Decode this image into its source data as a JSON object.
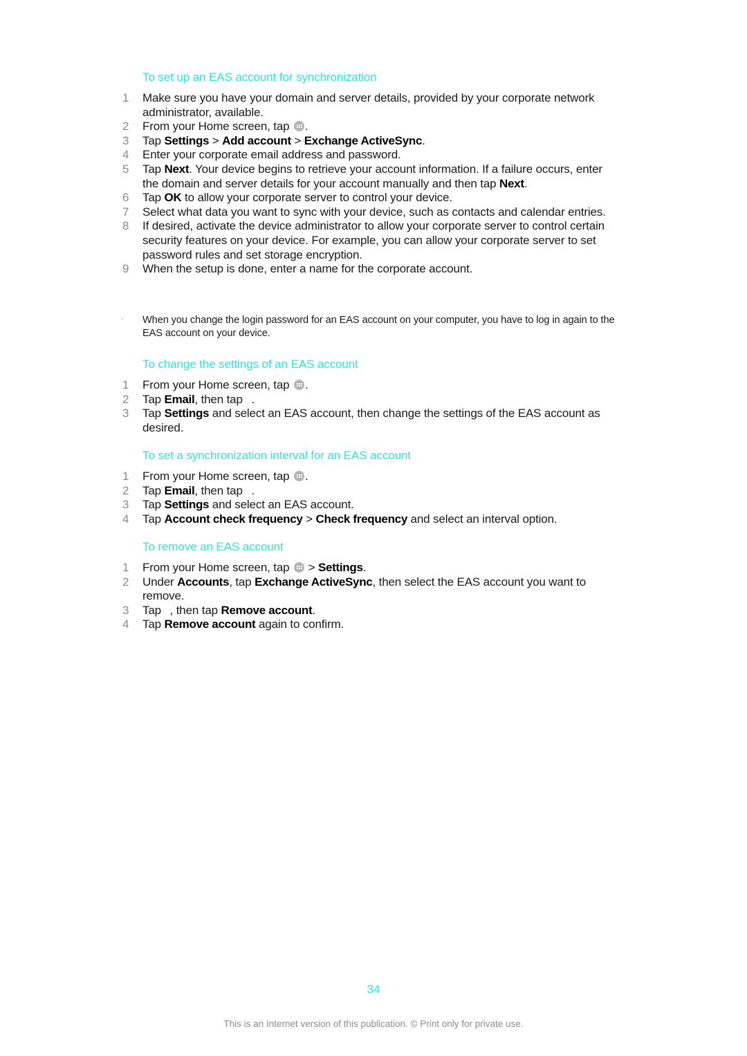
{
  "accent_color": "#2ee6d6",
  "sections": [
    {
      "heading": "To set up an EAS account for synchronization",
      "steps": [
        {
          "num": "1",
          "parts": [
            {
              "t": "Make sure you have your domain and server details, provided by your corporate network administrator, available."
            }
          ]
        },
        {
          "num": "2",
          "parts": [
            {
              "t": "From your Home screen, tap "
            },
            {
              "icon": "apps-icon"
            },
            {
              "t": "."
            }
          ]
        },
        {
          "num": "3",
          "parts": [
            {
              "t": "Tap "
            },
            {
              "b": "Settings"
            },
            {
              "t": " > "
            },
            {
              "b": "Add account"
            },
            {
              "t": " > "
            },
            {
              "b": "Exchange ActiveSync"
            },
            {
              "t": "."
            }
          ]
        },
        {
          "num": "4",
          "parts": [
            {
              "t": "Enter your corporate email address and password."
            }
          ]
        },
        {
          "num": "5",
          "parts": [
            {
              "t": "Tap "
            },
            {
              "b": "Next"
            },
            {
              "t": ". Your device begins to retrieve your account information. If a failure occurs, enter the domain and server details for your account manually and then tap "
            },
            {
              "b": "Next"
            },
            {
              "t": "."
            }
          ]
        },
        {
          "num": "6",
          "parts": [
            {
              "t": "Tap "
            },
            {
              "b": "OK"
            },
            {
              "t": " to allow your corporate server to control your device."
            }
          ]
        },
        {
          "num": "7",
          "parts": [
            {
              "t": "Select what data you want to sync with your device, such as contacts and calendar entries."
            }
          ]
        },
        {
          "num": "8",
          "parts": [
            {
              "t": "If desired, activate the device administrator to allow your corporate server to control certain security features on your device. For example, you can allow your corporate server to set password rules and set storage encryption."
            }
          ]
        },
        {
          "num": "9",
          "parts": [
            {
              "t": "When the setup is done, enter a name for the corporate account."
            }
          ]
        }
      ]
    },
    {
      "heading": "To change the settings of an EAS account",
      "steps": [
        {
          "num": "1",
          "parts": [
            {
              "t": "From your Home screen, tap "
            },
            {
              "icon": "apps-icon"
            },
            {
              "t": "."
            }
          ]
        },
        {
          "num": "2",
          "parts": [
            {
              "t": "Tap "
            },
            {
              "b": "Email"
            },
            {
              "t": ", then tap "
            },
            {
              "icon": "blank-icon"
            },
            {
              "t": "."
            }
          ]
        },
        {
          "num": "3",
          "parts": [
            {
              "t": "Tap "
            },
            {
              "b": "Settings"
            },
            {
              "t": " and select an EAS account, then change the settings of the EAS account as desired."
            }
          ]
        }
      ]
    },
    {
      "heading": "To set a synchronization interval for an EAS account",
      "steps": [
        {
          "num": "1",
          "parts": [
            {
              "t": "From your Home screen, tap "
            },
            {
              "icon": "apps-icon"
            },
            {
              "t": "."
            }
          ]
        },
        {
          "num": "2",
          "parts": [
            {
              "t": "Tap "
            },
            {
              "b": "Email"
            },
            {
              "t": ", then tap "
            },
            {
              "icon": "blank-icon"
            },
            {
              "t": "."
            }
          ]
        },
        {
          "num": "3",
          "parts": [
            {
              "t": "Tap "
            },
            {
              "b": "Settings"
            },
            {
              "t": " and select an EAS account."
            }
          ]
        },
        {
          "num": "4",
          "parts": [
            {
              "t": "Tap "
            },
            {
              "b": "Account check frequency"
            },
            {
              "t": " > "
            },
            {
              "b": "Check frequency"
            },
            {
              "t": " and select an interval option."
            }
          ]
        }
      ]
    },
    {
      "heading": "To remove an EAS account",
      "steps": [
        {
          "num": "1",
          "parts": [
            {
              "t": "From your Home screen, tap "
            },
            {
              "icon": "apps-icon"
            },
            {
              "t": " > "
            },
            {
              "b": "Settings"
            },
            {
              "t": "."
            }
          ]
        },
        {
          "num": "2",
          "parts": [
            {
              "t": "Under "
            },
            {
              "b": "Accounts"
            },
            {
              "t": ", tap "
            },
            {
              "b": "Exchange ActiveSync"
            },
            {
              "t": ", then select the EAS account you want to remove."
            }
          ]
        },
        {
          "num": "3",
          "parts": [
            {
              "t": "Tap "
            },
            {
              "icon": "blank-icon"
            },
            {
              "t": ", then tap "
            },
            {
              "b": "Remove account"
            },
            {
              "t": "."
            }
          ]
        },
        {
          "num": "4",
          "parts": [
            {
              "t": "Tap "
            },
            {
              "b": "Remove account"
            },
            {
              "t": " again to confirm."
            }
          ]
        }
      ]
    }
  ],
  "note": {
    "text": "When you change the login password for an EAS account on your computer, you have to log in again to the EAS account on your device."
  },
  "page_number": "34",
  "footer": "This is an Internet version of this publication. © Print only for private use."
}
